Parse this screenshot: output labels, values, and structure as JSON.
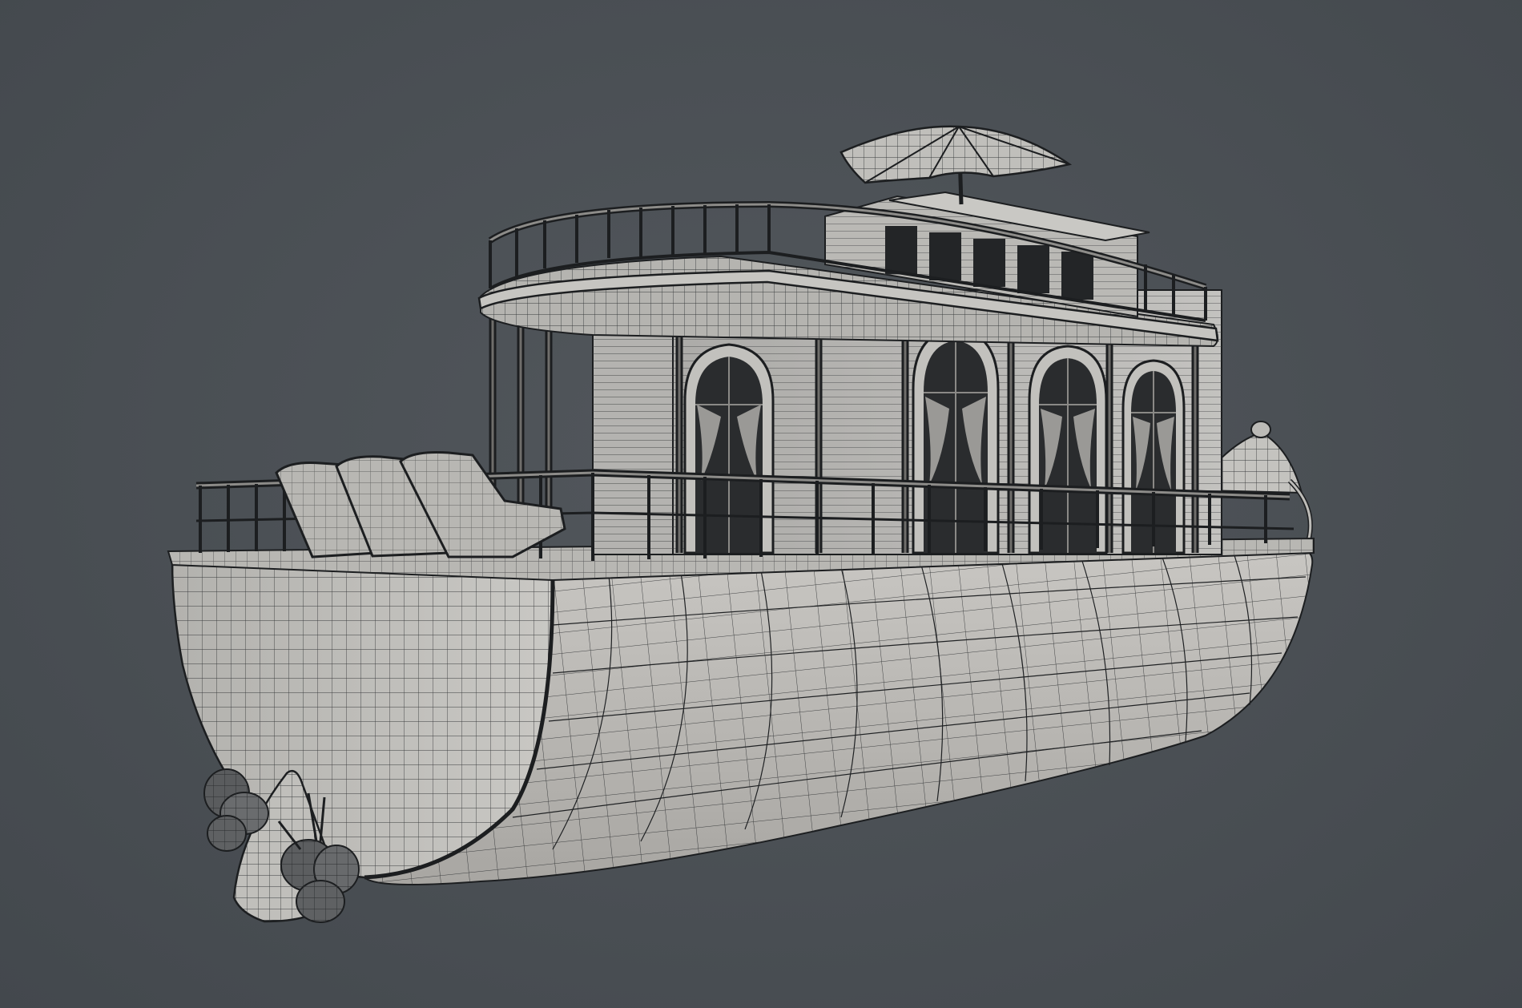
{
  "viewport": {
    "background_color": "#4b5055",
    "render_style": "wireframe-on-shaded",
    "wire_color": "#1b1d1f",
    "surface_color": "#bdbcb8"
  },
  "model": {
    "subject": "houseboat",
    "parts": [
      "hull",
      "lower-deck-railing",
      "deck-chairs",
      "cabin",
      "arched-windows",
      "curtains",
      "upper-deck-railing",
      "roof-cabin",
      "umbrella",
      "propellers",
      "rudder",
      "bow-dome"
    ]
  }
}
